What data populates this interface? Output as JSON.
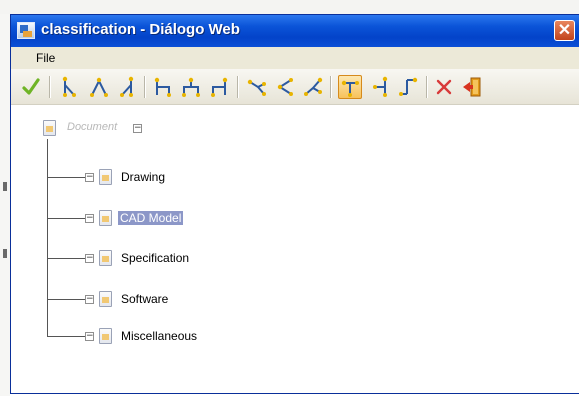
{
  "window": {
    "title": "classification - Diálogo Web",
    "close_glyph": "✕"
  },
  "menu": {
    "file_label": "File"
  },
  "toolbar": {
    "buttons": [
      {
        "name": "confirm-check-icon",
        "color": "#6fb426"
      },
      {
        "name": "branch-left-icon"
      },
      {
        "name": "branch-center-icon"
      },
      {
        "name": "branch-right-icon"
      },
      {
        "name": "bracket-left-icon"
      },
      {
        "name": "bracket-center-icon"
      },
      {
        "name": "bracket-right-icon"
      },
      {
        "name": "link-left-icon"
      },
      {
        "name": "link-center-icon"
      },
      {
        "name": "link-right-icon"
      },
      {
        "name": "tree-down-icon",
        "active": true
      },
      {
        "name": "tree-left-icon"
      },
      {
        "name": "tree-right-icon"
      },
      {
        "name": "delete-x-icon",
        "color": "#d83a3a"
      },
      {
        "name": "exit-door-icon",
        "color": "#e39b1b"
      }
    ]
  },
  "tree": {
    "root": {
      "label": "Document",
      "toggle": "⊟"
    },
    "children": [
      {
        "label": "Drawing",
        "toggle": "⊟",
        "selected": false
      },
      {
        "label": "CAD Model",
        "toggle": "⊟",
        "selected": true
      },
      {
        "label": "Specification",
        "toggle": "⊟",
        "selected": false
      },
      {
        "label": "Software",
        "toggle": "⊟",
        "selected": false
      },
      {
        "label": "Miscellaneous",
        "toggle": "⊟",
        "selected": false
      }
    ]
  },
  "colors": {
    "titlebar": "#0b54d8",
    "selection": "#8c97c8",
    "toolbar_icon": "#2c5aa0",
    "node_dot": "#e8b400"
  }
}
